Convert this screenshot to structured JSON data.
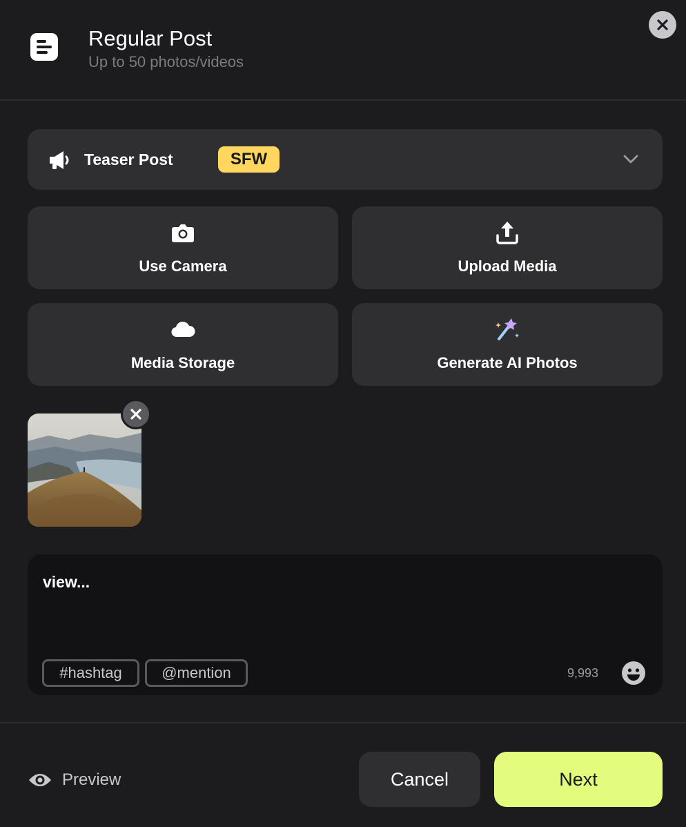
{
  "header": {
    "title": "Regular Post",
    "subtitle": "Up to 50 photos/videos",
    "icon": "post-list-icon"
  },
  "post_type": {
    "label": "Teaser Post",
    "badge": "SFW",
    "icon": "megaphone-icon",
    "badge_color": "#ffd75e"
  },
  "actions": [
    {
      "label": "Use Camera",
      "icon": "camera-icon"
    },
    {
      "label": "Upload Media",
      "icon": "upload-icon"
    },
    {
      "label": "Media Storage",
      "icon": "cloud-icon"
    },
    {
      "label": "Generate AI Photos",
      "icon": "magic-wand-icon"
    }
  ],
  "caption": {
    "text": "view...",
    "chips": [
      "#hashtag",
      "@mention"
    ],
    "remaining": "9,993"
  },
  "footer": {
    "preview_label": "Preview",
    "cancel_label": "Cancel",
    "next_label": "Next",
    "next_color": "#e3fc7d"
  }
}
